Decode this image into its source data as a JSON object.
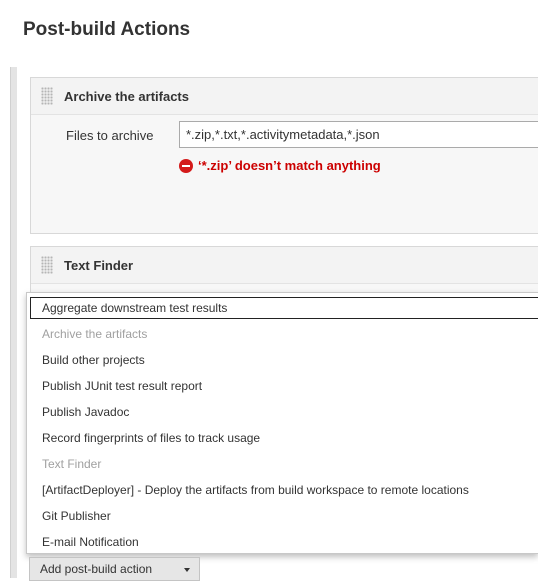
{
  "section": {
    "title": "Post-build Actions"
  },
  "archive": {
    "title": "Archive the artifacts",
    "field_label": "Files to archive",
    "field_value": "*.zip,*.txt,*.activitymetadata,*.json",
    "error": "‘*.zip’ doesn’t match anything",
    "error_icon": "no-entry-icon",
    "error_color": "#cc0000"
  },
  "text_finder": {
    "title": "Text Finder"
  },
  "menu": {
    "items": [
      {
        "label": "Aggregate downstream test results",
        "enabled": true,
        "focused": true
      },
      {
        "label": "Archive the artifacts",
        "enabled": false
      },
      {
        "label": "Build other projects",
        "enabled": true
      },
      {
        "label": "Publish JUnit test result report",
        "enabled": true
      },
      {
        "label": "Publish Javadoc",
        "enabled": true
      },
      {
        "label": "Record fingerprints of files to track usage",
        "enabled": true
      },
      {
        "label": "Text Finder",
        "enabled": false
      },
      {
        "label": "[ArtifactDeployer] - Deploy the artifacts from build workspace to remote locations",
        "enabled": true
      },
      {
        "label": "Git Publisher",
        "enabled": true
      },
      {
        "label": "E-mail Notification",
        "enabled": true
      }
    ]
  },
  "add_button": {
    "label": "Add post-build action",
    "icon": "caret-down-icon"
  }
}
